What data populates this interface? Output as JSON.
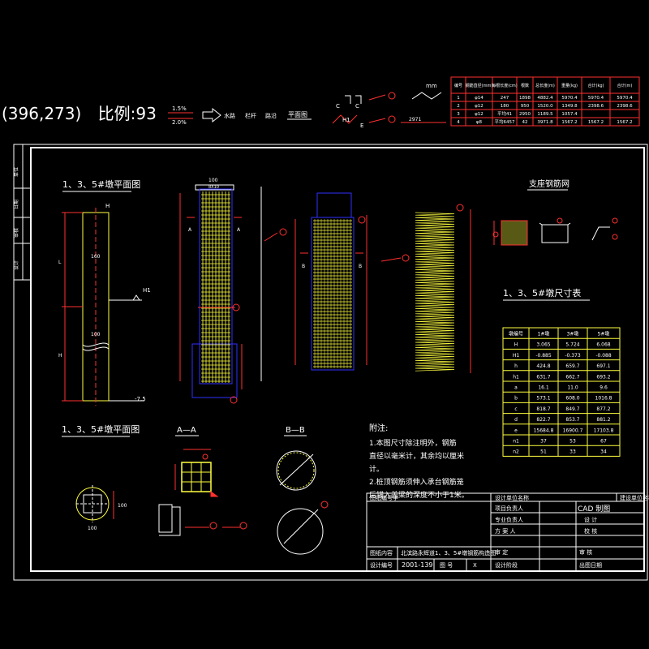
{
  "header": {
    "coord": "(396,273)",
    "scale": "比例:93",
    "slope_top": "1.5%",
    "slope_bottom": "2.0%",
    "legend_a": "水路",
    "legend_b": "栏杆",
    "legend_c": "路沿",
    "legend_plan": "平面图",
    "mm_label": "mm",
    "legend_marks": [
      "C",
      "C",
      "H1",
      "E",
      "2971"
    ]
  },
  "rebar_table": {
    "headers": [
      "编号",
      "钢筋直径(mm)",
      "每根长度(cm)",
      "根数",
      "总长度(m)",
      "重量(kg)",
      "合计(kg)",
      "合计(m)"
    ],
    "rows": [
      [
        "1",
        "φ14",
        "247",
        "1898",
        "4882.4",
        "5970.4",
        "5970.4",
        "5970.4"
      ],
      [
        "2",
        "φ12",
        "180",
        "950",
        "1520.0",
        "1349.8",
        "2398.6",
        "2398.6"
      ],
      [
        "3",
        "φ12",
        "平均41",
        "2950",
        "1189.5",
        "1057.4",
        "",
        ""
      ],
      [
        "4",
        "φ8",
        "平均6457",
        "42",
        "3971.8",
        "1567.2",
        "1567.2",
        "1567.2"
      ]
    ]
  },
  "drawing": {
    "title_elev": "1、3、5#墩平面图",
    "title_plan": "1、3、5#墩平面图",
    "title_support": "支座钢筋网",
    "title_dims": "1、3、5#墩尺寸表",
    "section_aa": "A—A",
    "section_bb": "B—B",
    "elev_labels": [
      "H",
      "H1",
      "L",
      "100",
      "160",
      "-7.5",
      "H"
    ],
    "cage_labels": [
      "100",
      "8X10",
      "A",
      "A",
      "B",
      "B",
      "φ8"
    ],
    "plan_dims": [
      "100",
      "100"
    ]
  },
  "dim_table": {
    "headers": [
      "墩编号",
      "1#墩",
      "3#墩",
      "5#墩"
    ],
    "rows": [
      [
        "H",
        "3.065",
        "5.724",
        "6.068"
      ],
      [
        "H1",
        "-0.885",
        "-0.373",
        "-0.088"
      ],
      [
        "h",
        "424.8",
        "659.7",
        "697.1"
      ],
      [
        "h1",
        "631.7",
        "662.7",
        "693.2"
      ],
      [
        "a",
        "16.1",
        "11.0",
        "9.6"
      ],
      [
        "b",
        "573.1",
        "608.0",
        "1016.8"
      ],
      [
        "c",
        "818.7",
        "849.7",
        "877.2"
      ],
      [
        "d",
        "822.7",
        "853.7",
        "881.2"
      ],
      [
        "e",
        "15684.8",
        "16900.7",
        "17103.8"
      ],
      [
        "n1",
        "37",
        "53",
        "67"
      ],
      [
        "n2",
        "51",
        "33",
        "34"
      ]
    ]
  },
  "notes": {
    "title": "附注:",
    "lines": [
      "1.本图尺寸除注明外，钢筋",
      "直径以毫米计，其余均以厘米",
      "计。",
      "2.桩顶钢筋须伸入承台钢筋笼",
      "后锚入盖梁的深度不小于1米。"
    ]
  },
  "title_block": {
    "project_label": "图纸编号字",
    "design_unit": "设计单位名称",
    "owner": "建设单位名称",
    "cad_label": "CAD 制图",
    "rows_left": [
      "项目负责人",
      "专业负责人",
      "方 案 人",
      "审 定",
      "图纸内容",
      "设计编号"
    ],
    "rows_right": [
      "设 计",
      "校 核",
      "审 核",
      "出图日期"
    ],
    "content": "北滨路永辉道1、3、5#墩钢筋构造图",
    "design_no": "2001-139",
    "sheet_label": "图 号",
    "sheet_no": "X",
    "check_label": "设计阶段"
  },
  "left_strip": [
    "单位",
    "日期",
    "审核",
    "设计"
  ]
}
